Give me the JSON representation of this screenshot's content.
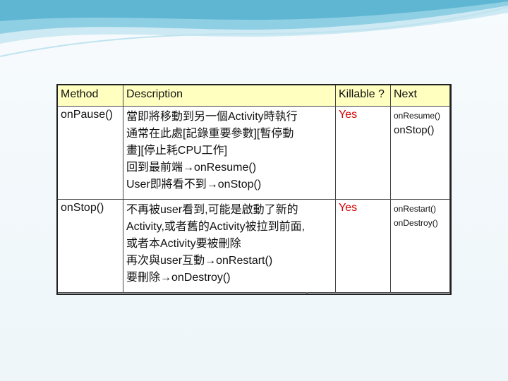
{
  "table": {
    "headers": {
      "method": "Method",
      "description": "Description",
      "killable": "Killable ?",
      "next": "Next"
    },
    "rows": [
      {
        "method": "onPause()",
        "description": [
          "當即將移動到另一個Activity時執行",
          "通常在此處[記錄重要參數][暫停動",
          "畫][停止耗CPU工作]",
          "回到最前端→onResume()",
          "User即將看不到→onStop()"
        ],
        "killable": "Yes",
        "next": [
          "onResume()",
          "onStop()"
        ]
      },
      {
        "method": "onStop()",
        "description": [
          "不再被user看到,可能是啟動了新的",
          "Activity,或者舊的Activity被拉到前面,",
          "或者本Activity要被刪除",
          "再次與user互動→onRestart()",
          "要刪除→onDestroy()"
        ],
        "killable": "Yes",
        "next": [
          "onRestart()",
          "onDestroy()"
        ]
      }
    ]
  },
  "colors": {
    "header_bg": "#ffffc0",
    "killable_text": "#d40000",
    "swoosh_dark": "#5fb6d3",
    "swoosh_light": "#bfe3ef"
  }
}
